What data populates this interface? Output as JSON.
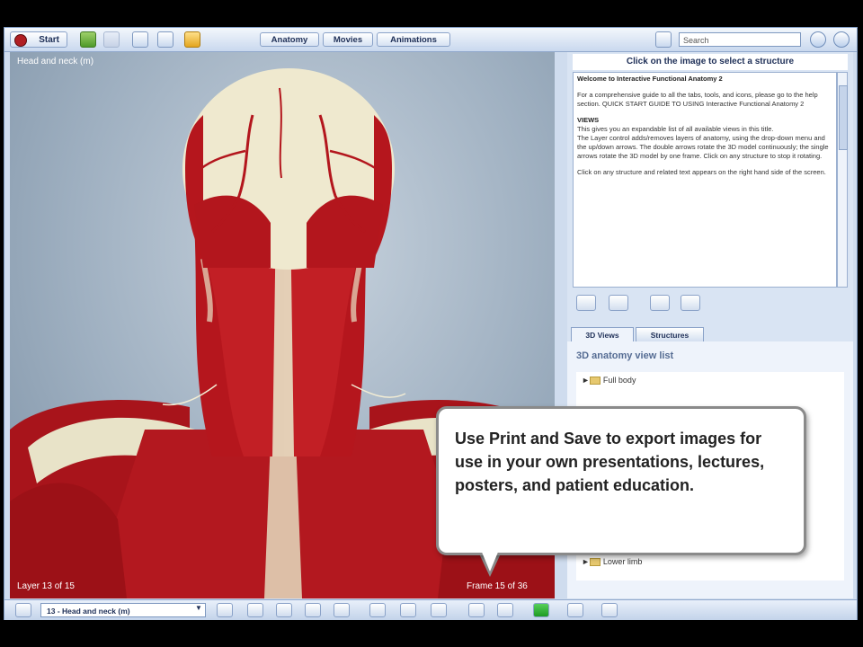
{
  "toolbar": {
    "start_label": "Start",
    "tabs": [
      "Anatomy",
      "Movies",
      "Animations"
    ],
    "search_placeholder": "Search"
  },
  "viewer": {
    "title": "Head and neck (m)",
    "layer_text": "Layer 13 of 15",
    "frame_text": "Frame 15 of 36"
  },
  "info_panel": {
    "header": "Click on the image to select a structure",
    "intro_title": "Welcome to Interactive Functional Anatomy 2",
    "p1": "For a comprehensive guide to all the tabs, tools, and icons, please go to the help section. QUICK START GUIDE TO USING Interactive Functional Anatomy 2",
    "views_heading": "VIEWS",
    "p2": "This gives you an expandable list of all available views in this title.",
    "p3": "The Layer control adds/removes layers of anatomy, using the drop-down menu and the up/down arrows. The double arrows rotate the 3D model continuously; the single arrows rotate the 3D model by one frame. Click on any structure to stop it rotating.",
    "p4": "Click on any structure and related text appears on the right hand side of the screen."
  },
  "tabs_panel": {
    "tabs": [
      "3D Views",
      "Structures"
    ],
    "heading": "3D anatomy view list",
    "items": [
      "Full body",
      "Lower limb"
    ]
  },
  "bottom_bar": {
    "layer_select": "13 - Head and neck (m)"
  },
  "callout": {
    "text": "Use Print and Save to export images for use in your own presentations, lectures, posters, and patient education."
  },
  "colors": {
    "muscle": "#b0161c",
    "bone": "#efe9cf",
    "ui_blue": "#cfdcee"
  }
}
